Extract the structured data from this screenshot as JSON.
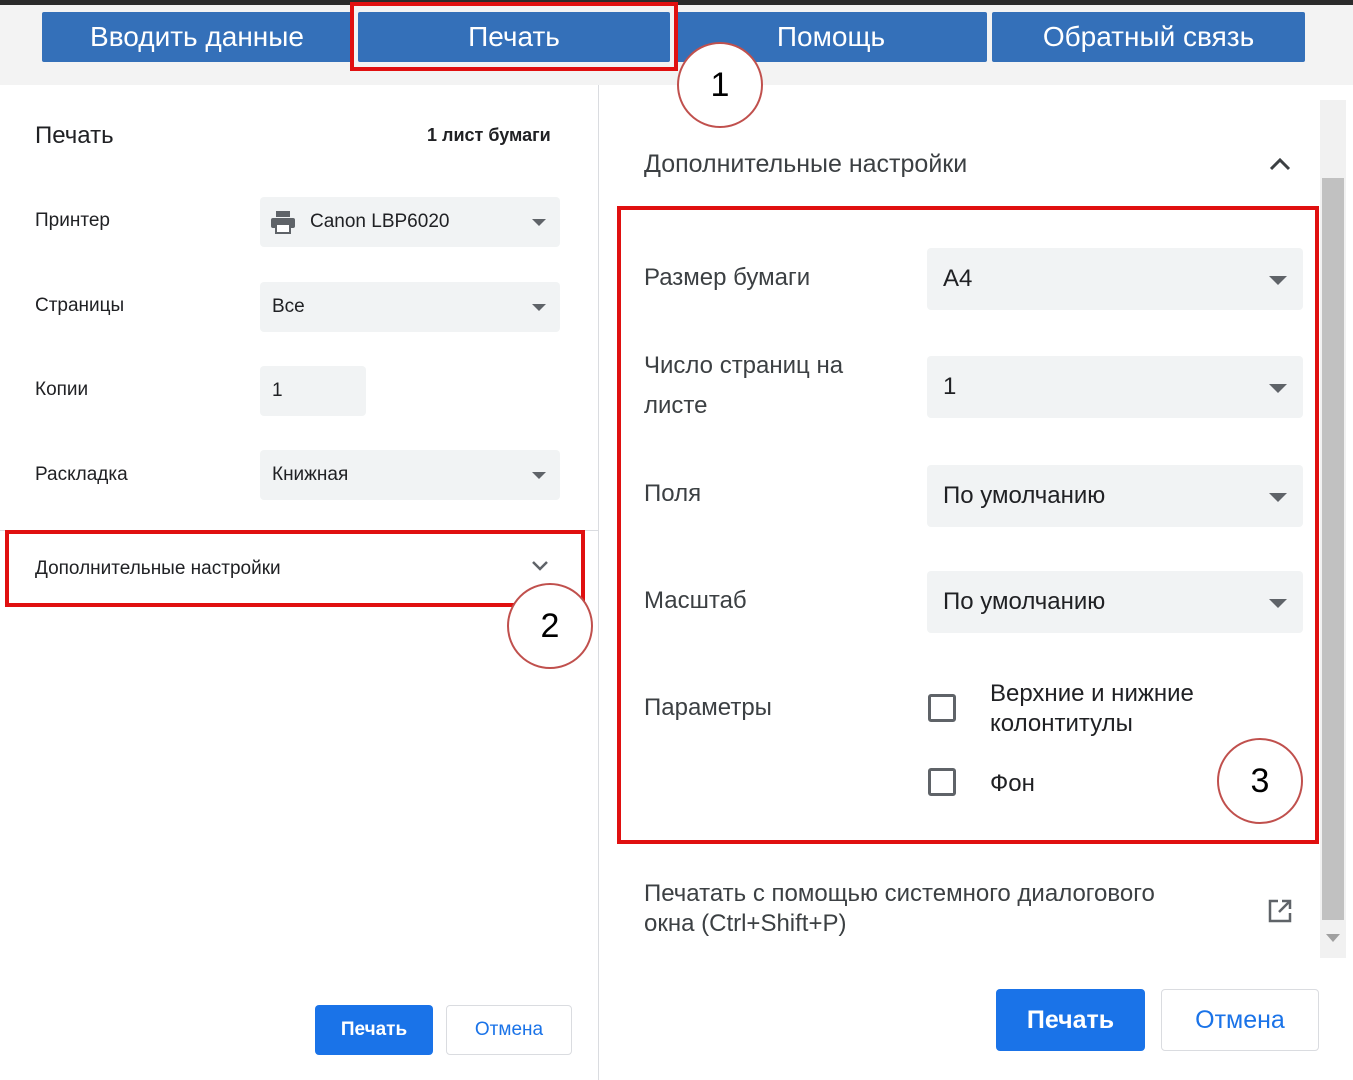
{
  "toolbar": {
    "enter_data": "Вводить данные",
    "print": "Печать",
    "help": "Помощь",
    "feedback": "Обратный связь"
  },
  "annotations": [
    "1",
    "2",
    "3"
  ],
  "left_panel": {
    "title": "Печать",
    "sheet_count": "1 лист бумаги",
    "printer_label": "Принтер",
    "printer_value": "Canon LBP6020",
    "pages_label": "Страницы",
    "pages_value": "Все",
    "copies_label": "Копии",
    "copies_value": "1",
    "layout_label": "Раскладка",
    "layout_value": "Книжная",
    "more_settings": "Дополнительные настройки",
    "print_button": "Печать",
    "cancel_button": "Отмена"
  },
  "right_panel": {
    "section_title": "Дополнительные настройки",
    "paper_size_label": "Размер бумаги",
    "paper_size_value": "A4",
    "pages_per_sheet_label_1": "Число страниц на",
    "pages_per_sheet_label_2": "листе",
    "pages_per_sheet_value": "1",
    "margins_label": "Поля",
    "margins_value": "По умолчанию",
    "scale_label": "Масштаб",
    "scale_value": "По умолчанию",
    "options_label": "Параметры",
    "headers_footers_1": "Верхние и нижние",
    "headers_footers_2": "колонтитулы",
    "background": "Фон",
    "system_dialog_1": "Печатать с помощью системного диалогового",
    "system_dialog_2": "окна (Ctrl+Shift+P)",
    "print_button": "Печать",
    "cancel_button": "Отмена"
  },
  "icons": [
    "printer-icon",
    "chevron-up-icon",
    "chevron-down-icon",
    "open-external-icon",
    "dropdown-arrow-icon"
  ]
}
